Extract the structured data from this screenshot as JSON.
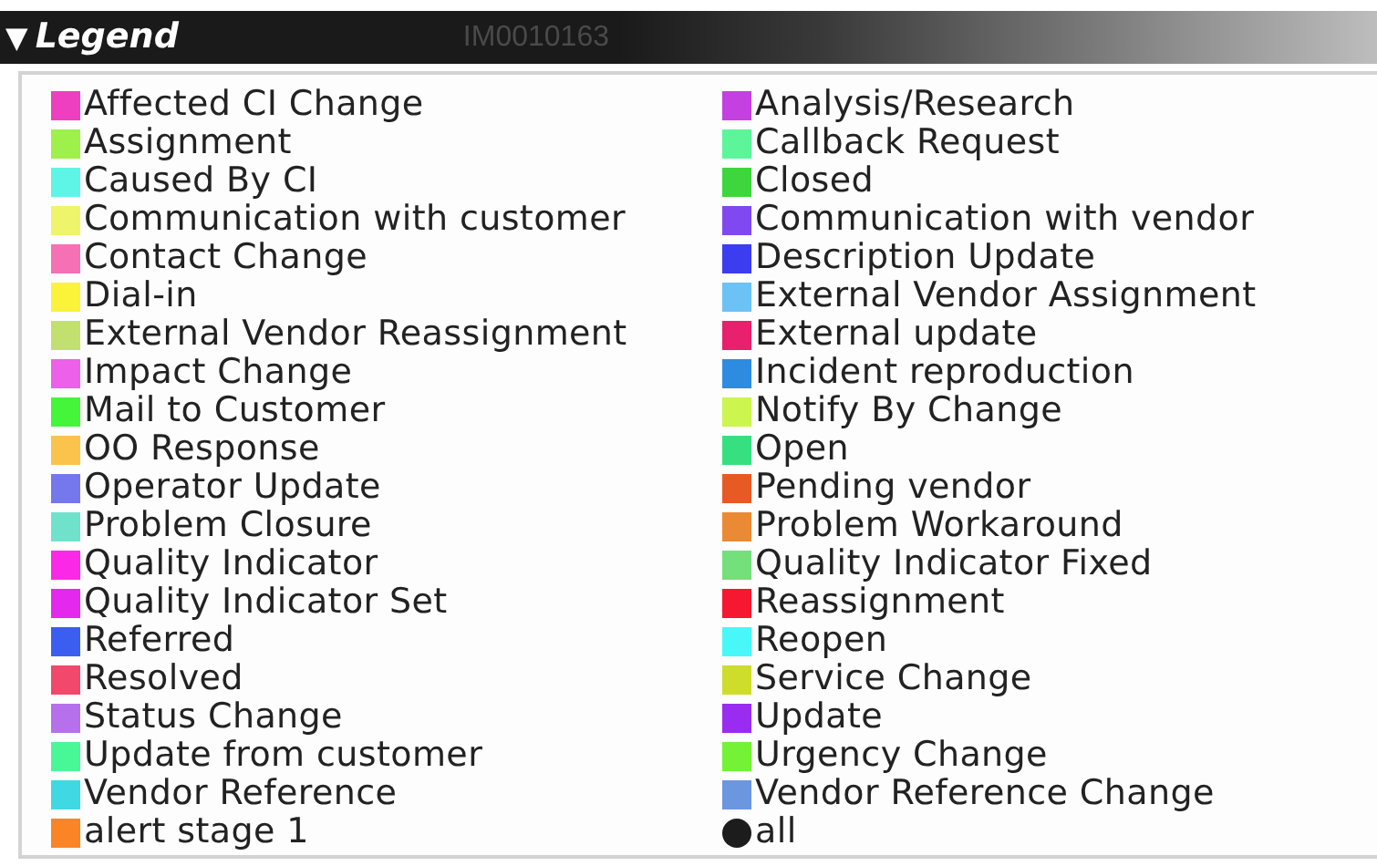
{
  "legend": {
    "title": "Legend",
    "toggle": "▼",
    "expanded": true,
    "background_label": "IM0010163",
    "items": [
      {
        "label": "Affected CI Change",
        "color": "#ee3fc0",
        "kind": "square"
      },
      {
        "label": "Analysis/Research",
        "color": "#c540e0",
        "kind": "square"
      },
      {
        "label": "Assignment",
        "color": "#9ef04a",
        "kind": "square"
      },
      {
        "label": "Callback Request",
        "color": "#5cf59a",
        "kind": "square"
      },
      {
        "label": "Caused By CI",
        "color": "#5ef5e6",
        "kind": "square"
      },
      {
        "label": "Closed",
        "color": "#3dd63d",
        "kind": "square"
      },
      {
        "label": "Communication with customer",
        "color": "#eef56a",
        "kind": "square"
      },
      {
        "label": "Communication with vendor",
        "color": "#8048f0",
        "kind": "square"
      },
      {
        "label": "Contact Change",
        "color": "#f570b4",
        "kind": "square"
      },
      {
        "label": "Description Update",
        "color": "#3c3cf0",
        "kind": "square"
      },
      {
        "label": "Dial-in",
        "color": "#fbf23a",
        "kind": "square"
      },
      {
        "label": "External Vendor Assignment",
        "color": "#6cc2f5",
        "kind": "square"
      },
      {
        "label": "External Vendor Reassignment",
        "color": "#c2e070",
        "kind": "square"
      },
      {
        "label": "External update",
        "color": "#e8206e",
        "kind": "square"
      },
      {
        "label": "Impact Change",
        "color": "#ec60ea",
        "kind": "square"
      },
      {
        "label": "Incident reproduction",
        "color": "#2e8ce0",
        "kind": "square"
      },
      {
        "label": "Mail to Customer",
        "color": "#44f53a",
        "kind": "square"
      },
      {
        "label": "Notify By Change",
        "color": "#ccf550",
        "kind": "square"
      },
      {
        "label": "OO Response",
        "color": "#fbc24c",
        "kind": "square"
      },
      {
        "label": "Open",
        "color": "#36e080",
        "kind": "square"
      },
      {
        "label": "Operator Update",
        "color": "#7478ec",
        "kind": "square"
      },
      {
        "label": "Pending vendor",
        "color": "#e85a24",
        "kind": "square"
      },
      {
        "label": "Problem Closure",
        "color": "#70e2cc",
        "kind": "square"
      },
      {
        "label": "Problem Workaround",
        "color": "#ea8a34",
        "kind": "square"
      },
      {
        "label": "Quality Indicator",
        "color": "#fb28e8",
        "kind": "square"
      },
      {
        "label": "Quality Indicator Fixed",
        "color": "#74e07c",
        "kind": "square"
      },
      {
        "label": "Quality Indicator Set",
        "color": "#e428ee",
        "kind": "square"
      },
      {
        "label": "Reassignment",
        "color": "#f51830",
        "kind": "square"
      },
      {
        "label": "Referred",
        "color": "#3c5ef0",
        "kind": "square"
      },
      {
        "label": "Reopen",
        "color": "#48f8f8",
        "kind": "square"
      },
      {
        "label": "Resolved",
        "color": "#f2486c",
        "kind": "square"
      },
      {
        "label": "Service Change",
        "color": "#cedc2c",
        "kind": "square"
      },
      {
        "label": "Status Change",
        "color": "#b670ec",
        "kind": "square"
      },
      {
        "label": "Update",
        "color": "#9a2cf2",
        "kind": "square"
      },
      {
        "label": "Update from customer",
        "color": "#48f896",
        "kind": "square"
      },
      {
        "label": "Urgency Change",
        "color": "#74f236",
        "kind": "square"
      },
      {
        "label": "Vendor Reference",
        "color": "#40d8e2",
        "kind": "square"
      },
      {
        "label": "Vendor Reference Change",
        "color": "#6c96e0",
        "kind": "square"
      },
      {
        "label": "alert stage 1",
        "color": "#fb8424",
        "kind": "square"
      },
      {
        "label": "all",
        "color": "#1c1c1c",
        "kind": "dot"
      }
    ]
  }
}
